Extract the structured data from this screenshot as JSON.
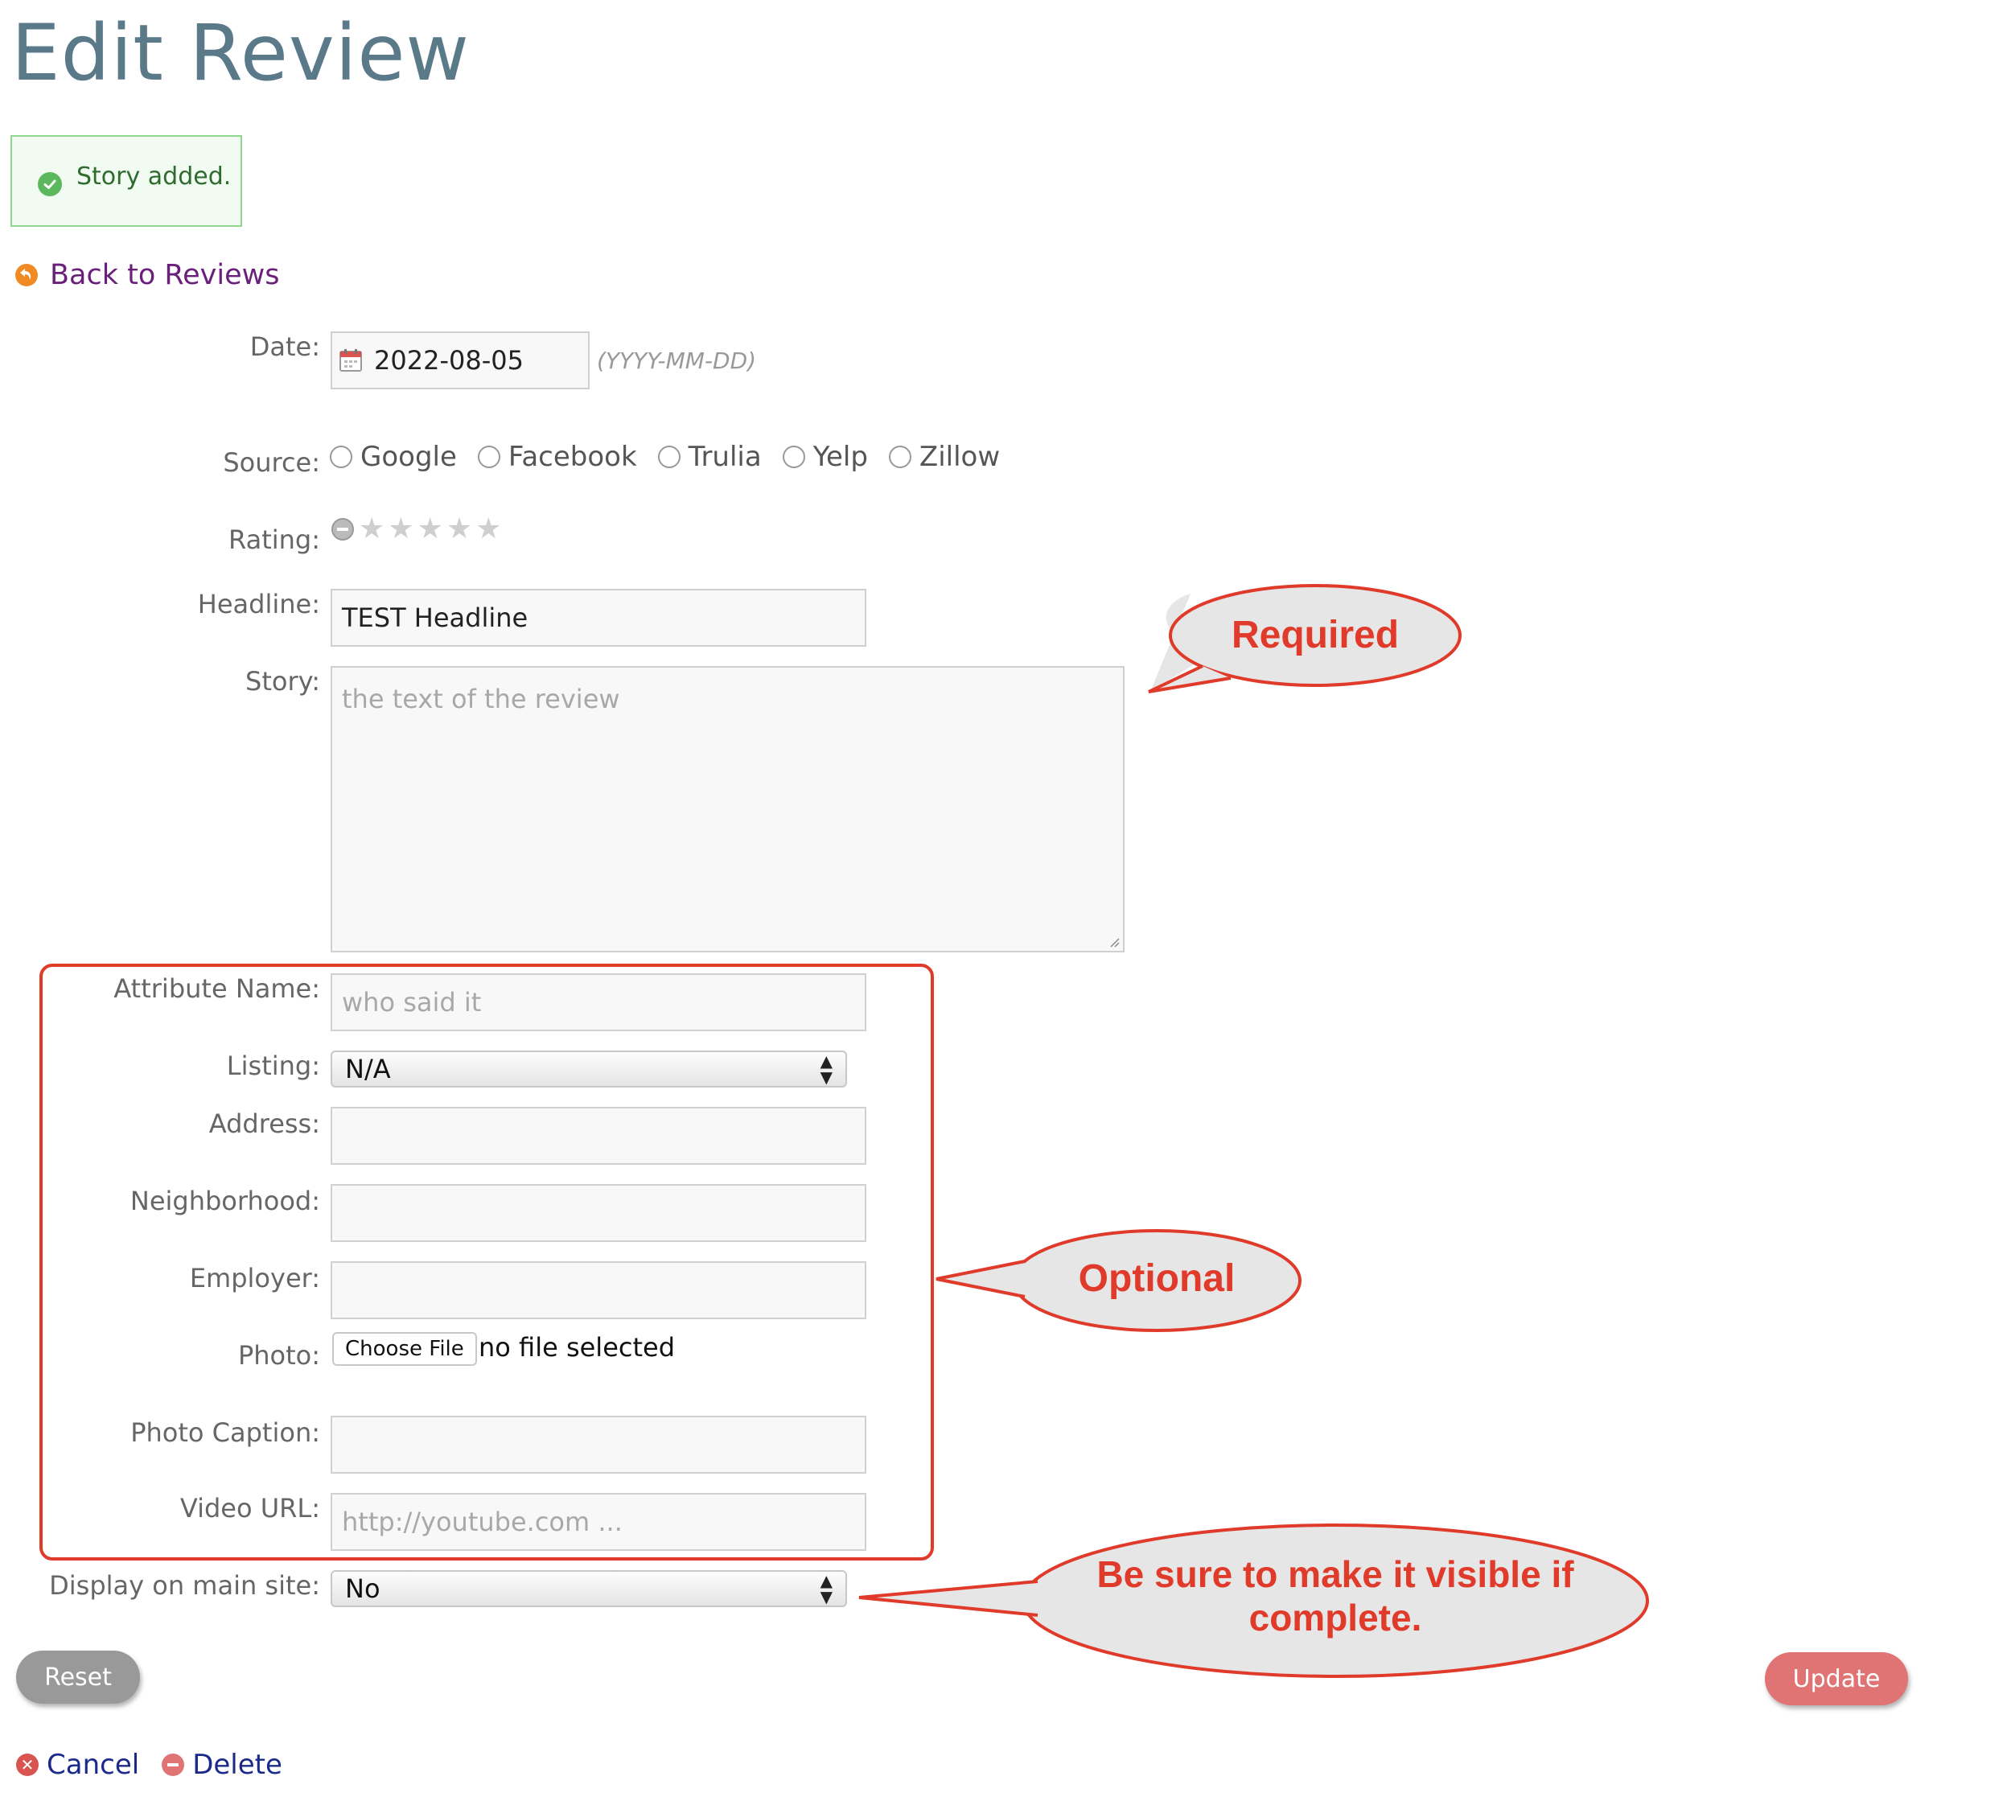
{
  "page": {
    "title": "Edit Review"
  },
  "alert": {
    "message": "Story added.",
    "color": "#5cb85c"
  },
  "nav": {
    "back_label": "Back to Reviews"
  },
  "form": {
    "date": {
      "label": "Date:",
      "value": "2022-08-05",
      "hint": "(YYYY-MM-DD)"
    },
    "source": {
      "label": "Source:",
      "options": [
        "Google",
        "Facebook",
        "Trulia",
        "Yelp",
        "Zillow"
      ]
    },
    "rating": {
      "label": "Rating:",
      "max_stars": 5,
      "value": 0
    },
    "headline": {
      "label": "Headline:",
      "value": "TEST Headline"
    },
    "story": {
      "label": "Story:",
      "placeholder": "the text of the review"
    },
    "attribute_name": {
      "label": "Attribute Name:",
      "placeholder": "who said it"
    },
    "listing": {
      "label": "Listing:",
      "value": "N/A"
    },
    "address": {
      "label": "Address:"
    },
    "neighborhood": {
      "label": "Neighborhood:"
    },
    "employer": {
      "label": "Employer:"
    },
    "photo": {
      "label": "Photo:",
      "button": "Choose File",
      "status": "no file selected"
    },
    "photo_caption": {
      "label": "Photo Caption:"
    },
    "video_url": {
      "label": "Video URL:",
      "placeholder": "http://youtube.com ..."
    },
    "display_main": {
      "label": "Display on main site:",
      "value": "No"
    }
  },
  "buttons": {
    "reset": "Reset",
    "update": "Update"
  },
  "links": {
    "cancel": "Cancel",
    "delete": "Delete"
  },
  "callouts": {
    "required": "Required",
    "optional": "Optional",
    "visible_line1": "Be sure to make it visible if",
    "visible_line2": "complete.",
    "color": "#e03a2a"
  }
}
